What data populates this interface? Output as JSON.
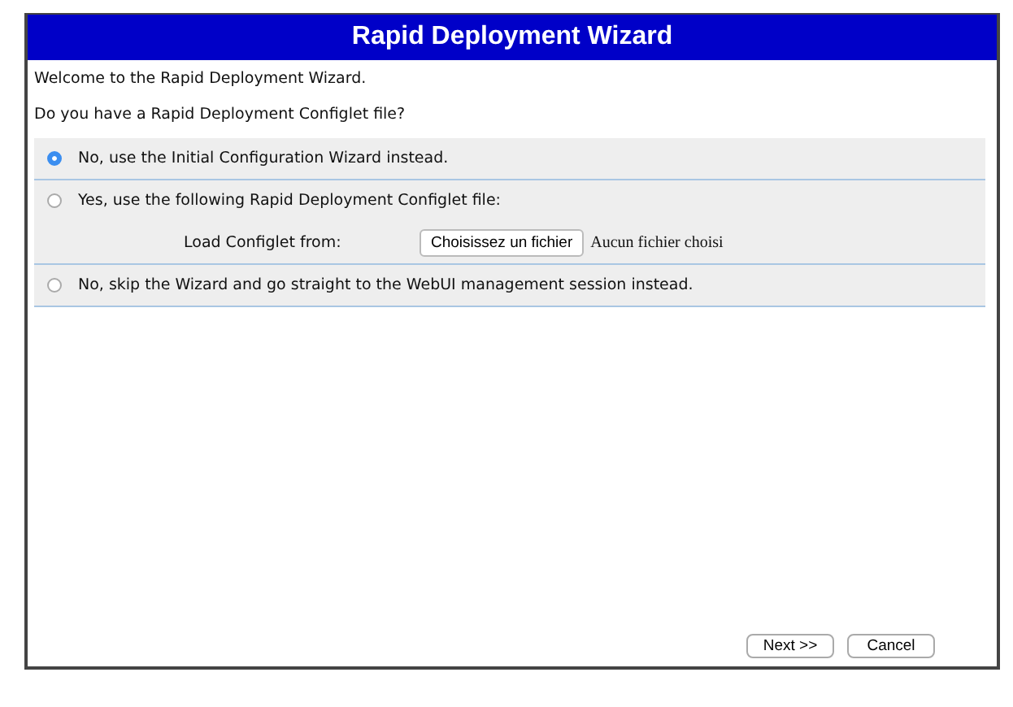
{
  "window": {
    "title": "Rapid Deployment Wizard"
  },
  "intro": "Welcome to the Rapid Deployment Wizard.",
  "question": "Do you have a Rapid Deployment Configlet file?",
  "options": [
    {
      "label": "No, use the Initial Configuration Wizard instead.",
      "selected": true
    },
    {
      "label": "Yes, use the following Rapid Deployment Configlet file:",
      "selected": false,
      "file": {
        "label": "Load Configlet from:",
        "button": "Choisissez un fichier",
        "status": "Aucun fichier choisi"
      }
    },
    {
      "label": "No, skip the Wizard and go straight to the WebUI management session instead.",
      "selected": false
    }
  ],
  "buttons": [
    "Next >>",
    "Cancel"
  ]
}
